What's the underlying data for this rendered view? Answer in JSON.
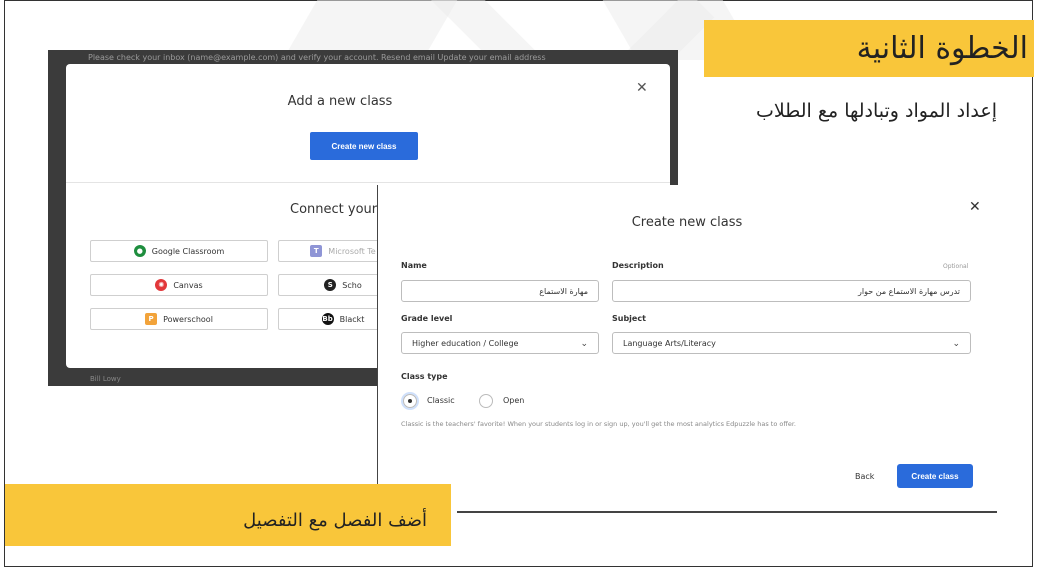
{
  "slide": {
    "step_title": "الخطوة الثانية",
    "step_subtitle": "إعداد المواد وتبادلها مع الطلاب",
    "caption": "أضف الفصل مع التفصيل",
    "accent_color": "#f9c63a"
  },
  "shot1": {
    "topbar_text": "Please check your inbox (name@example.com) and verify your account.   Resend email   Update your email address",
    "bottom_text": "Bill Lowy",
    "modal": {
      "title": "Add a new class",
      "create_button": "Create new class",
      "connect_title": "Connect your",
      "lms": [
        {
          "label": "Google Classroom",
          "icon": "google-classroom-icon"
        },
        {
          "label": "Microsoft Te",
          "icon": "microsoft-teams-icon"
        },
        {
          "label": "Canvas",
          "icon": "canvas-icon"
        },
        {
          "label": "Scho",
          "icon": "schoology-icon"
        },
        {
          "label": "Powerschool",
          "icon": "powerschool-icon"
        },
        {
          "label": "Blackt",
          "icon": "blackboard-icon"
        }
      ]
    }
  },
  "shot2": {
    "title": "Create new class",
    "name_label": "Name",
    "name_value": "مهارة الاستماع",
    "description_label": "Description",
    "optional_label": "Optional",
    "description_value": "تدرس مهارة الاستماع من حوار",
    "grade_label": "Grade level",
    "grade_value": "Higher education / College",
    "subject_label": "Subject",
    "subject_value": "Language Arts/Literacy",
    "class_type_label": "Class type",
    "classic_label": "Classic",
    "open_label": "Open",
    "hint": "Classic is the teachers' favorite! When your students log in or sign up, you'll get the most analytics Edpuzzle has to offer.",
    "back_label": "Back",
    "create_label": "Create class",
    "selected_type": "Classic"
  }
}
